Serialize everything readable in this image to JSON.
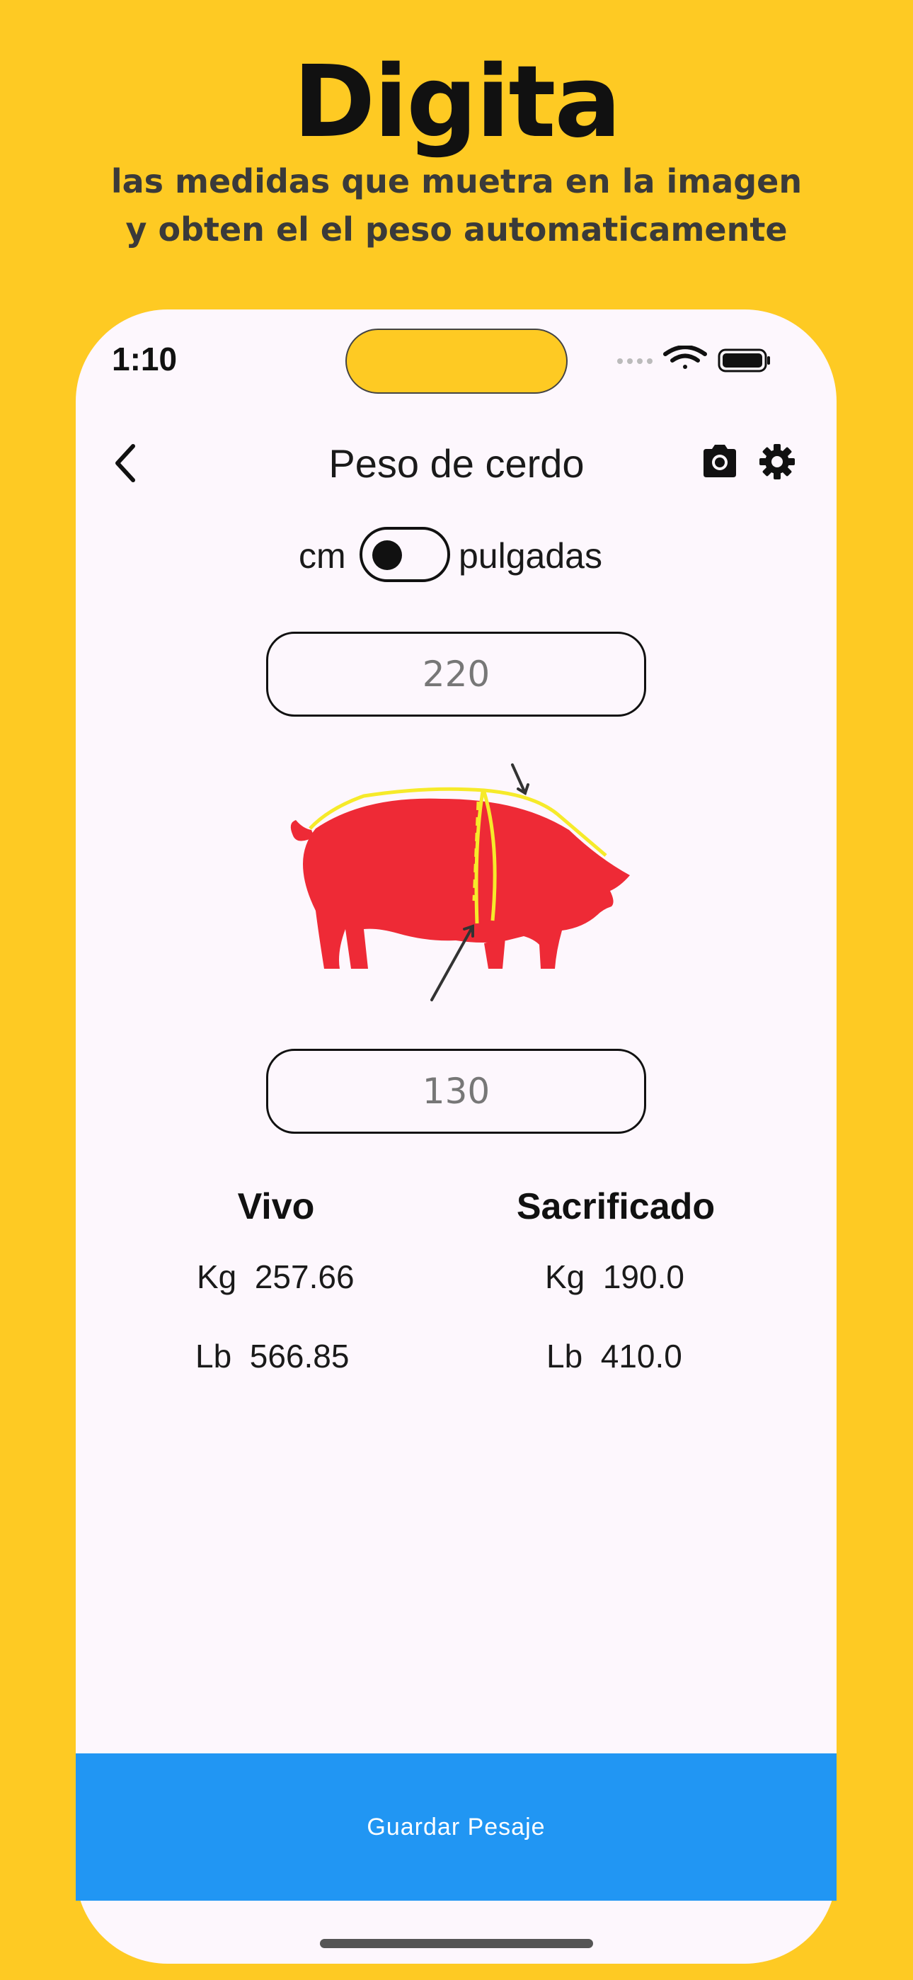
{
  "promo": {
    "title": "Digita",
    "subtitle_line1": "las medidas que muetra en la imagen",
    "subtitle_line2": "y obten el el peso automaticamente"
  },
  "status_bar": {
    "time": "1:10"
  },
  "header": {
    "title": "Peso de cerdo"
  },
  "units": {
    "left_label": "cm",
    "right_label": "pulgadas",
    "toggle_on": false
  },
  "inputs": {
    "length": {
      "placeholder": "220",
      "value": ""
    },
    "girth": {
      "placeholder": "130",
      "value": ""
    }
  },
  "results": {
    "live": {
      "heading": "Vivo",
      "kg_label": "Kg",
      "kg_value": "257.66",
      "lb_label": "Lb",
      "lb_value": "566.85"
    },
    "slaughtered": {
      "heading": "Sacrificado",
      "kg_label": "Kg",
      "kg_value": "190.0",
      "lb_label": "Lb",
      "lb_value": "410.0"
    }
  },
  "actions": {
    "save_label": "Guardar Pesaje"
  },
  "icons": [
    "back-chevron-icon",
    "camera-icon",
    "gear-icon",
    "wifi-icon",
    "battery-icon"
  ],
  "colors": {
    "background": "#FECA23",
    "screen": "#FDF7FD",
    "save_bar": "#2196F3",
    "pig": "#EE2A36",
    "measure_lines": "#F6EA2A"
  }
}
